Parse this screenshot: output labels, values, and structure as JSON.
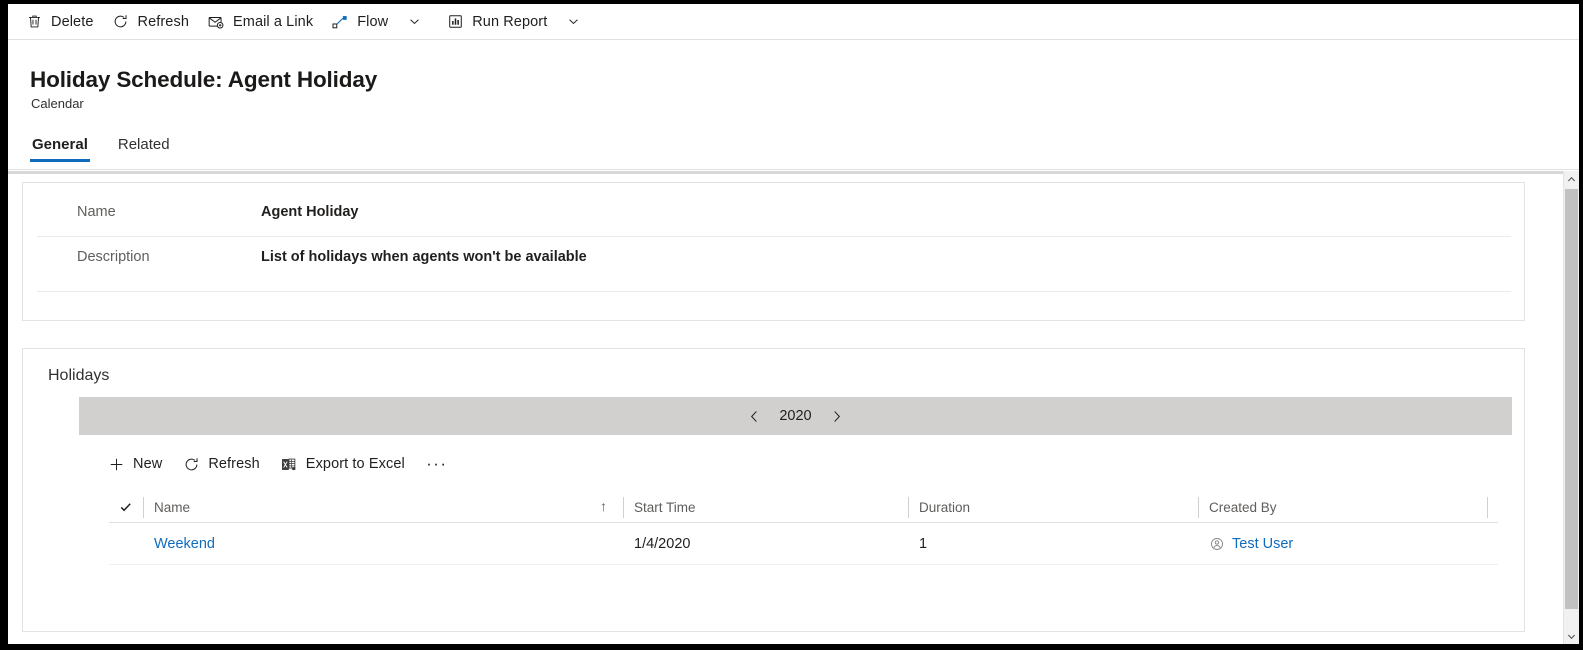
{
  "topbar": {
    "commands": [
      {
        "id": "delete",
        "label": "Delete",
        "icon": "trash-icon",
        "has_caret": false
      },
      {
        "id": "refresh",
        "label": "Refresh",
        "icon": "refresh-icon",
        "has_caret": false
      },
      {
        "id": "email-a-link",
        "label": "Email a Link",
        "icon": "email-link-icon",
        "has_caret": false
      },
      {
        "id": "flow",
        "label": "Flow",
        "icon": "flow-icon",
        "has_caret": true
      },
      {
        "id": "run-report",
        "label": "Run Report",
        "icon": "report-icon",
        "has_caret": true
      }
    ]
  },
  "header": {
    "title": "Holiday Schedule: Agent Holiday",
    "subtitle": "Calendar",
    "tabs": [
      {
        "id": "general",
        "label": "General",
        "active": true
      },
      {
        "id": "related",
        "label": "Related",
        "active": false
      }
    ]
  },
  "general": {
    "fields": [
      {
        "id": "name",
        "label": "Name",
        "value": "Agent Holiday"
      },
      {
        "id": "description",
        "label": "Description",
        "value": "List of holidays when agents won't be available"
      }
    ]
  },
  "holidays": {
    "section_title": "Holidays",
    "year_nav": {
      "prev_icon": "chevron-left-icon",
      "next_icon": "chevron-right-icon",
      "year": "2020"
    },
    "commands": [
      {
        "id": "new",
        "label": "New",
        "icon": "plus-icon"
      },
      {
        "id": "refresh",
        "label": "Refresh",
        "icon": "refresh-icon"
      },
      {
        "id": "export-to-excel",
        "label": "Export to Excel",
        "icon": "excel-icon"
      }
    ],
    "overflow_label": "···",
    "grid": {
      "select_all_icon": "checkmark-icon",
      "columns": [
        {
          "id": "name",
          "label": "Name",
          "sorted": true,
          "sort_icon": "↑"
        },
        {
          "id": "start-time",
          "label": "Start Time",
          "sorted": false,
          "sort_icon": ""
        },
        {
          "id": "duration",
          "label": "Duration",
          "sorted": false,
          "sort_icon": ""
        },
        {
          "id": "created-by",
          "label": "Created By",
          "sorted": false,
          "sort_icon": ""
        }
      ],
      "rows": [
        {
          "name": "Weekend",
          "start_time": "1/4/2020",
          "duration": "1",
          "created_by": "Test User",
          "created_by_icon": "person-circle-icon"
        }
      ]
    }
  },
  "colors": {
    "accent": "#0f6cbd",
    "link": "#0f6cbd",
    "year_bar": "#d2d0ce",
    "text_primary": "#201f1e",
    "text_secondary": "#605e5c"
  },
  "scrollbar": {
    "up_icon": "chevron-up-icon",
    "down_icon": "chevron-down-icon"
  }
}
